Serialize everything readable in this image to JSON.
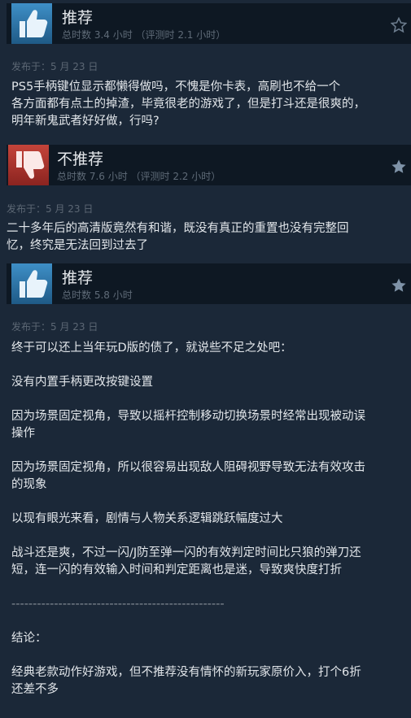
{
  "reviews": [
    {
      "verdict": "推荐",
      "hours": "总时数 3.4 小时 （评测时 2.1 小时）",
      "date": "发布于：5 月 23 日",
      "icon": "thumbs-up-icon",
      "star_style": "outline",
      "paragraphs": [
        "PS5手柄键位显示都懒得做吗，不愧是你卡表，高刷也不给一个",
        "各方面都有点土的掉渣，毕竟很老的游戏了，但是打斗还是很爽的，",
        "明年新鬼武者好好做，行吗?"
      ]
    },
    {
      "verdict": "不推荐",
      "hours": "总时数 7.6 小时 （评测时 2.2 小时）",
      "date": "发布于：5 月 23 日",
      "icon": "thumbs-down-icon",
      "star_style": "filled",
      "paragraphs": [
        "二十多年后的高清版竟然有和谐，既没有真正的重置也没有完整回",
        "忆，终究是无法回到过去了"
      ]
    },
    {
      "verdict": "推荐",
      "hours": "总时数 5.8 小时",
      "date": "发布于：5 月 23 日",
      "icon": "thumbs-up-icon",
      "star_style": "filled",
      "paragraphs": [
        "终于可以还上当年玩D版的债了，就说些不足之处吧：",
        "",
        "没有内置手柄更改按键设置",
        "",
        "因为场景固定视角，导致以摇杆控制移动切换场景时经常出现被动误",
        "操作",
        "",
        "因为场景固定视角，所以很容易出现敌人阻碍视野导致无法有效攻击",
        "的现象",
        "",
        "以现有眼光来看，剧情与人物关系逻辑跳跃幅度过大",
        "",
        "战斗还是爽，不过一闪/J防至弹一闪的有效判定时间比只狼的弹刀还",
        "短，连一闪的有效输入时间和判定距离也是迷，导致爽快度打折",
        "",
        "--------------------------------------------------",
        "",
        "结论：",
        "",
        "经典老款动作好游戏，但不推荐没有情怀的新玩家原价入，打个6折",
        "还差不多"
      ]
    }
  ],
  "colors": {
    "background": "#1b2838",
    "header_bg": "#0e1823",
    "thumb_up": "#2f6f9e",
    "thumb_down": "#a2302a"
  }
}
